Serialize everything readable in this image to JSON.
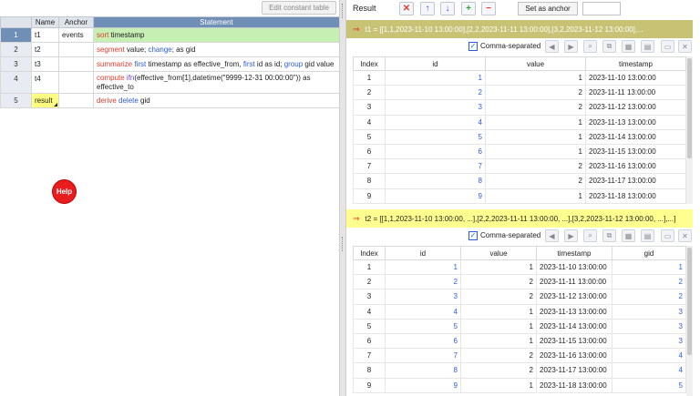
{
  "toolbar": {
    "edit_constant_table": "Edit constant table"
  },
  "grid": {
    "headers": {
      "name": "Name",
      "anchor": "Anchor",
      "statement": "Statement"
    },
    "rows": [
      {
        "num": "1",
        "name": "t1",
        "anchor": "events",
        "stmt": [
          {
            "t": "sort",
            "c": "red"
          },
          {
            "t": " timestamp",
            "c": ""
          }
        ]
      },
      {
        "num": "2",
        "name": "t2",
        "anchor": "",
        "stmt": [
          {
            "t": "segment",
            "c": "red"
          },
          {
            "t": " value; ",
            "c": ""
          },
          {
            "t": "change",
            "c": "blue"
          },
          {
            "t": "; as gid",
            "c": ""
          }
        ]
      },
      {
        "num": "3",
        "name": "t3",
        "anchor": "",
        "stmt": [
          {
            "t": "summarize",
            "c": "red"
          },
          {
            "t": " ",
            "c": ""
          },
          {
            "t": "first",
            "c": "blue"
          },
          {
            "t": " timestamp as effective_from, ",
            "c": ""
          },
          {
            "t": "first",
            "c": "blue"
          },
          {
            "t": " id as id; ",
            "c": ""
          },
          {
            "t": "group",
            "c": "blue"
          },
          {
            "t": " gid  value",
            "c": ""
          }
        ]
      },
      {
        "num": "4",
        "name": "t4",
        "anchor": "",
        "stmt": [
          {
            "t": "compute",
            "c": "red"
          },
          {
            "t": " ",
            "c": ""
          },
          {
            "t": "ifn",
            "c": "pur"
          },
          {
            "t": "(effective_from[1],datetime(\"9999-12-31 00:00:00\"))  as effective_to",
            "c": ""
          }
        ]
      },
      {
        "num": "5",
        "name": "result",
        "anchor": "",
        "stmt": [
          {
            "t": "derive",
            "c": "red"
          },
          {
            "t": " ",
            "c": ""
          },
          {
            "t": "delete",
            "c": "blue"
          },
          {
            "t": " gid",
            "c": ""
          }
        ]
      }
    ]
  },
  "help_label": "Help",
  "result_panel": {
    "title": "Result",
    "set_as_anchor": "Set as anchor",
    "anchor_value": "",
    "t1_bar": "t1 = [[1,1,2023-11-10 13:00:00],[2,2,2023-11-11 13:00:00],[3,2,2023-11-12 13:00:00],...",
    "t2_bar": "t2 = [[1,1,2023-11-10 13:00:00, ...],[2,2,2023-11-11 13:00:00, ...],[3,2,2023-11-12 13:00:00, ...],...]",
    "comma_separated": "Comma-separated",
    "t1_table": {
      "headers": [
        "Index",
        "id",
        "value",
        "timestamp"
      ],
      "rows": [
        [
          "1",
          "1",
          "1",
          "2023-11-10 13:00:00"
        ],
        [
          "2",
          "2",
          "2",
          "2023-11-11 13:00:00"
        ],
        [
          "3",
          "3",
          "2",
          "2023-11-12 13:00:00"
        ],
        [
          "4",
          "4",
          "1",
          "2023-11-13 13:00:00"
        ],
        [
          "5",
          "5",
          "1",
          "2023-11-14 13:00:00"
        ],
        [
          "6",
          "6",
          "1",
          "2023-11-15 13:00:00"
        ],
        [
          "7",
          "7",
          "2",
          "2023-11-16 13:00:00"
        ],
        [
          "8",
          "8",
          "2",
          "2023-11-17 13:00:00"
        ],
        [
          "9",
          "9",
          "1",
          "2023-11-18 13:00:00"
        ]
      ]
    },
    "t2_table": {
      "headers": [
        "Index",
        "id",
        "value",
        "timestamp",
        "gid"
      ],
      "rows": [
        [
          "1",
          "1",
          "1",
          "2023-11-10 13:00:00",
          "1"
        ],
        [
          "2",
          "2",
          "2",
          "2023-11-11 13:00:00",
          "2"
        ],
        [
          "3",
          "3",
          "2",
          "2023-11-12 13:00:00",
          "2"
        ],
        [
          "4",
          "4",
          "1",
          "2023-11-13 13:00:00",
          "3"
        ],
        [
          "5",
          "5",
          "1",
          "2023-11-14 13:00:00",
          "3"
        ],
        [
          "6",
          "6",
          "1",
          "2023-11-15 13:00:00",
          "3"
        ],
        [
          "7",
          "7",
          "2",
          "2023-11-16 13:00:00",
          "4"
        ],
        [
          "8",
          "8",
          "2",
          "2023-11-17 13:00:00",
          "4"
        ],
        [
          "9",
          "9",
          "1",
          "2023-11-18 13:00:00",
          "5"
        ]
      ]
    }
  },
  "icons": {
    "delete": "close-icon",
    "up": "arrow-up-icon",
    "down": "arrow-down-icon",
    "add": "plus-icon",
    "remove": "minus-icon"
  },
  "colors": {
    "accent_blue": "#6f8fb7",
    "result_yellow": "#ffff80",
    "green_row": "#c6efb3",
    "t1_bar": "#c8c275",
    "t2_bar": "#ffff90",
    "keyword_red": "#e23c2c",
    "keyword_blue": "#2b5ce0",
    "help_red": "#e81d1d"
  }
}
